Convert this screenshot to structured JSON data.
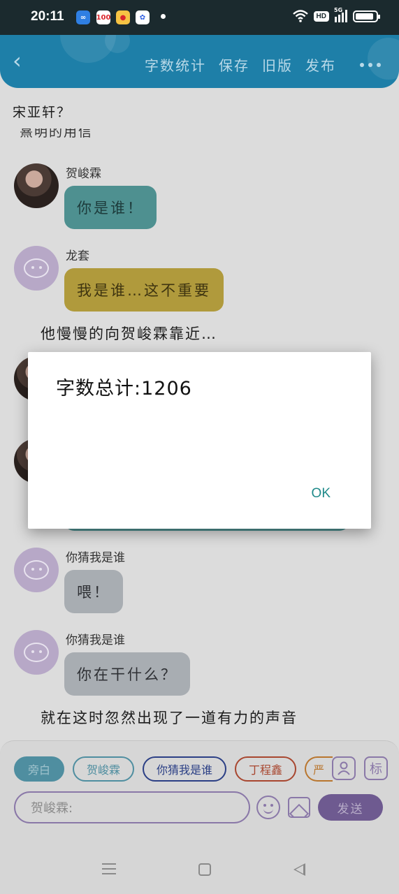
{
  "status_bar": {
    "time": "20:11",
    "icons": [
      "infinity-app-icon",
      "calendar-icon",
      "weibo-icon",
      "baidu-icon"
    ],
    "wifi": "wifi-icon",
    "hd_label": "HD",
    "network_label": "5G",
    "battery_level": 0.9
  },
  "header": {
    "back_icon": "back-arrow-icon",
    "menu": [
      "字数统计",
      "保存",
      "旧版",
      "发布"
    ],
    "more_icon": "more-dots-icon",
    "color": "#1e7fa8"
  },
  "content": {
    "top_line": "宋亚轩？",
    "partial_line": "熹明的用信",
    "messages": [
      {
        "name": "贺峻霖",
        "text": "你是谁！",
        "avatar": "photo-avatar",
        "color": "#4e9090"
      },
      {
        "name": "龙套",
        "text": "我是谁…这不重要",
        "avatar": "bot-avatar",
        "color": "#b09a3c"
      }
    ],
    "narration_1": "他慢慢的向贺峻霖靠近…",
    "messages_2": [
      {
        "name": "你猜我是谁",
        "text": "喂！",
        "avatar": "bot-avatar",
        "color": "#a8adb2"
      },
      {
        "name": "你猜我是谁",
        "text": "你在干什么？",
        "avatar": "bot-avatar",
        "color": "#a8adb2"
      }
    ],
    "narration_2": "就在这时忽然出现了一道有力的声音"
  },
  "panel": {
    "chips": [
      "旁白",
      "贺峻霖",
      "你猜我是谁",
      "丁程鑫",
      "严"
    ],
    "person_icon": "person-icon",
    "tag_label": "标",
    "input_placeholder": "贺峻霖:",
    "emoji_icon": "emoji-icon",
    "image_icon": "image-icon",
    "send_label": "发送"
  },
  "dialog": {
    "message": "字数总计:1206",
    "ok_label": "OK"
  },
  "navbar": {
    "icons": [
      "menu-icon",
      "home-icon",
      "back-icon"
    ]
  }
}
